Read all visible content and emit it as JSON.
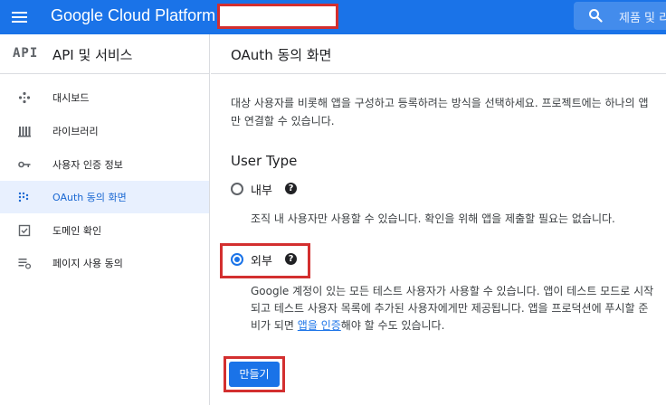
{
  "header": {
    "brand": "Google Cloud Platform",
    "search_placeholder": "제품 및 리"
  },
  "sidebar": {
    "logo": "API",
    "title": "API 및 서비스",
    "items": [
      {
        "label": "대시보드",
        "icon": "dashboard-icon"
      },
      {
        "label": "라이브러리",
        "icon": "library-icon"
      },
      {
        "label": "사용자 인증 정보",
        "icon": "key-icon"
      },
      {
        "label": "OAuth 동의 화면",
        "icon": "consent-icon",
        "active": true
      },
      {
        "label": "도메인 확인",
        "icon": "checkbox-icon"
      },
      {
        "label": "페이지 사용 동의",
        "icon": "settings-list-icon"
      }
    ]
  },
  "main": {
    "title": "OAuth 동의 화면",
    "intro": "대상 사용자를 비롯해 앱을 구성하고 등록하려는 방식을 선택하세요. 프로젝트에는 하나의 앱만 연결할 수 있습니다.",
    "user_type_title": "User Type",
    "internal": {
      "label": "내부",
      "desc": "조직 내 사용자만 사용할 수 있습니다. 확인을 위해 앱을 제출할 필요는 없습니다."
    },
    "external": {
      "label": "외부",
      "desc_before": "Google 계정이 있는 모든 테스트 사용자가 사용할 수 있습니다. 앱이 테스트 모드로 시작되고 테스트 사용자 목록에 추가된 사용자에게만 제공됩니다. 앱을 프로덕션에 푸시할 준비가 되면 ",
      "desc_link": "앱을 인증",
      "desc_after": "해야 할 수도 있습니다."
    },
    "help_glyph": "?",
    "create_label": "만들기"
  },
  "colors": {
    "topbar": "#1a73e8",
    "accent": "#1a73e8",
    "highlight": "#d32f2f",
    "active_bg": "#e8f0fe"
  }
}
